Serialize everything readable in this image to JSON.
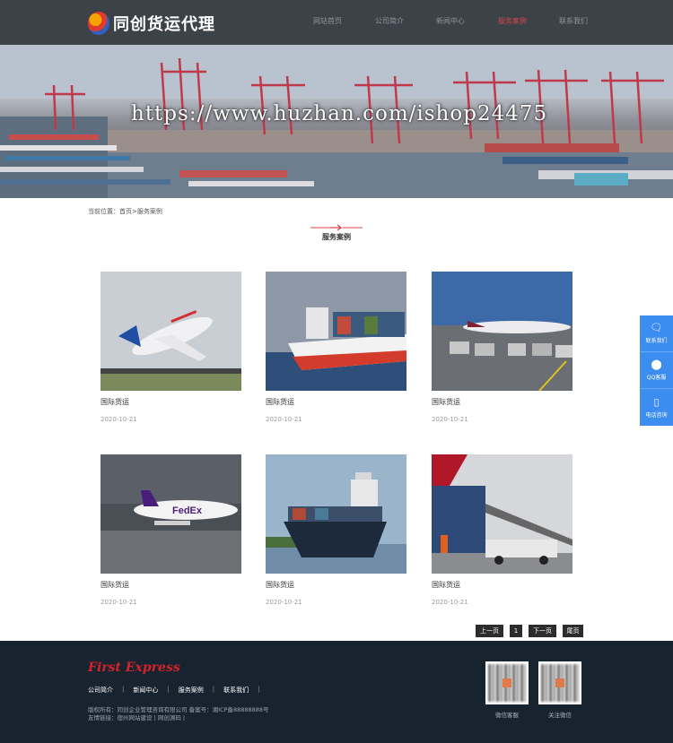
{
  "header": {
    "logo_text": "同创货运代理",
    "nav": [
      {
        "label": "网站首页",
        "active": false
      },
      {
        "label": "公司简介",
        "active": false
      },
      {
        "label": "新闻中心",
        "active": false
      },
      {
        "label": "服务案例",
        "active": true
      },
      {
        "label": "联系我们",
        "active": false
      }
    ]
  },
  "banner": {
    "watermark": "https://www.huzhan.com/ishop24475"
  },
  "breadcrumb": "当前位置：首页>服务案例",
  "section": {
    "title": "服务案例"
  },
  "cases": [
    {
      "title": "国际货运",
      "date": "2020-10-21",
      "image": "cargo-plane-image"
    },
    {
      "title": "国际货运",
      "date": "2020-10-21",
      "image": "container-ship-image"
    },
    {
      "title": "国际货运",
      "date": "2020-10-21",
      "image": "airport-cargo-image"
    },
    {
      "title": "国际货运",
      "date": "2020-10-21",
      "image": "fedex-plane-image"
    },
    {
      "title": "国际货运",
      "date": "2020-10-21",
      "image": "ship-front-image"
    },
    {
      "title": "国际货运",
      "date": "2020-10-21",
      "image": "loading-plane-image"
    }
  ],
  "pagination": {
    "prev": "上一页",
    "current": "1",
    "next": "下一页",
    "last": "尾页"
  },
  "side": [
    {
      "label": "联系我们",
      "icon": "chat-icon"
    },
    {
      "label": "QQ客服",
      "icon": "qq-icon"
    },
    {
      "label": "电话咨询",
      "icon": "phone-icon"
    }
  ],
  "footer": {
    "brand": "First Express",
    "links": [
      "公司简介",
      "新闻中心",
      "服务案例",
      "联系我们"
    ],
    "copyright": "版权所有：同创企业管理咨询有限公司 备案号：湘ICP备88888888号",
    "friend_links": "友情链接：宿州网站建设 | 网创源码 |",
    "qr_codes": [
      {
        "label": "微信客服"
      },
      {
        "label": "关注微信"
      }
    ]
  },
  "colors": {
    "header_bg": "#3b4248",
    "footer_bg": "#182330",
    "accent_red": "#d9434a",
    "side_blue": "#3d8cf0"
  }
}
